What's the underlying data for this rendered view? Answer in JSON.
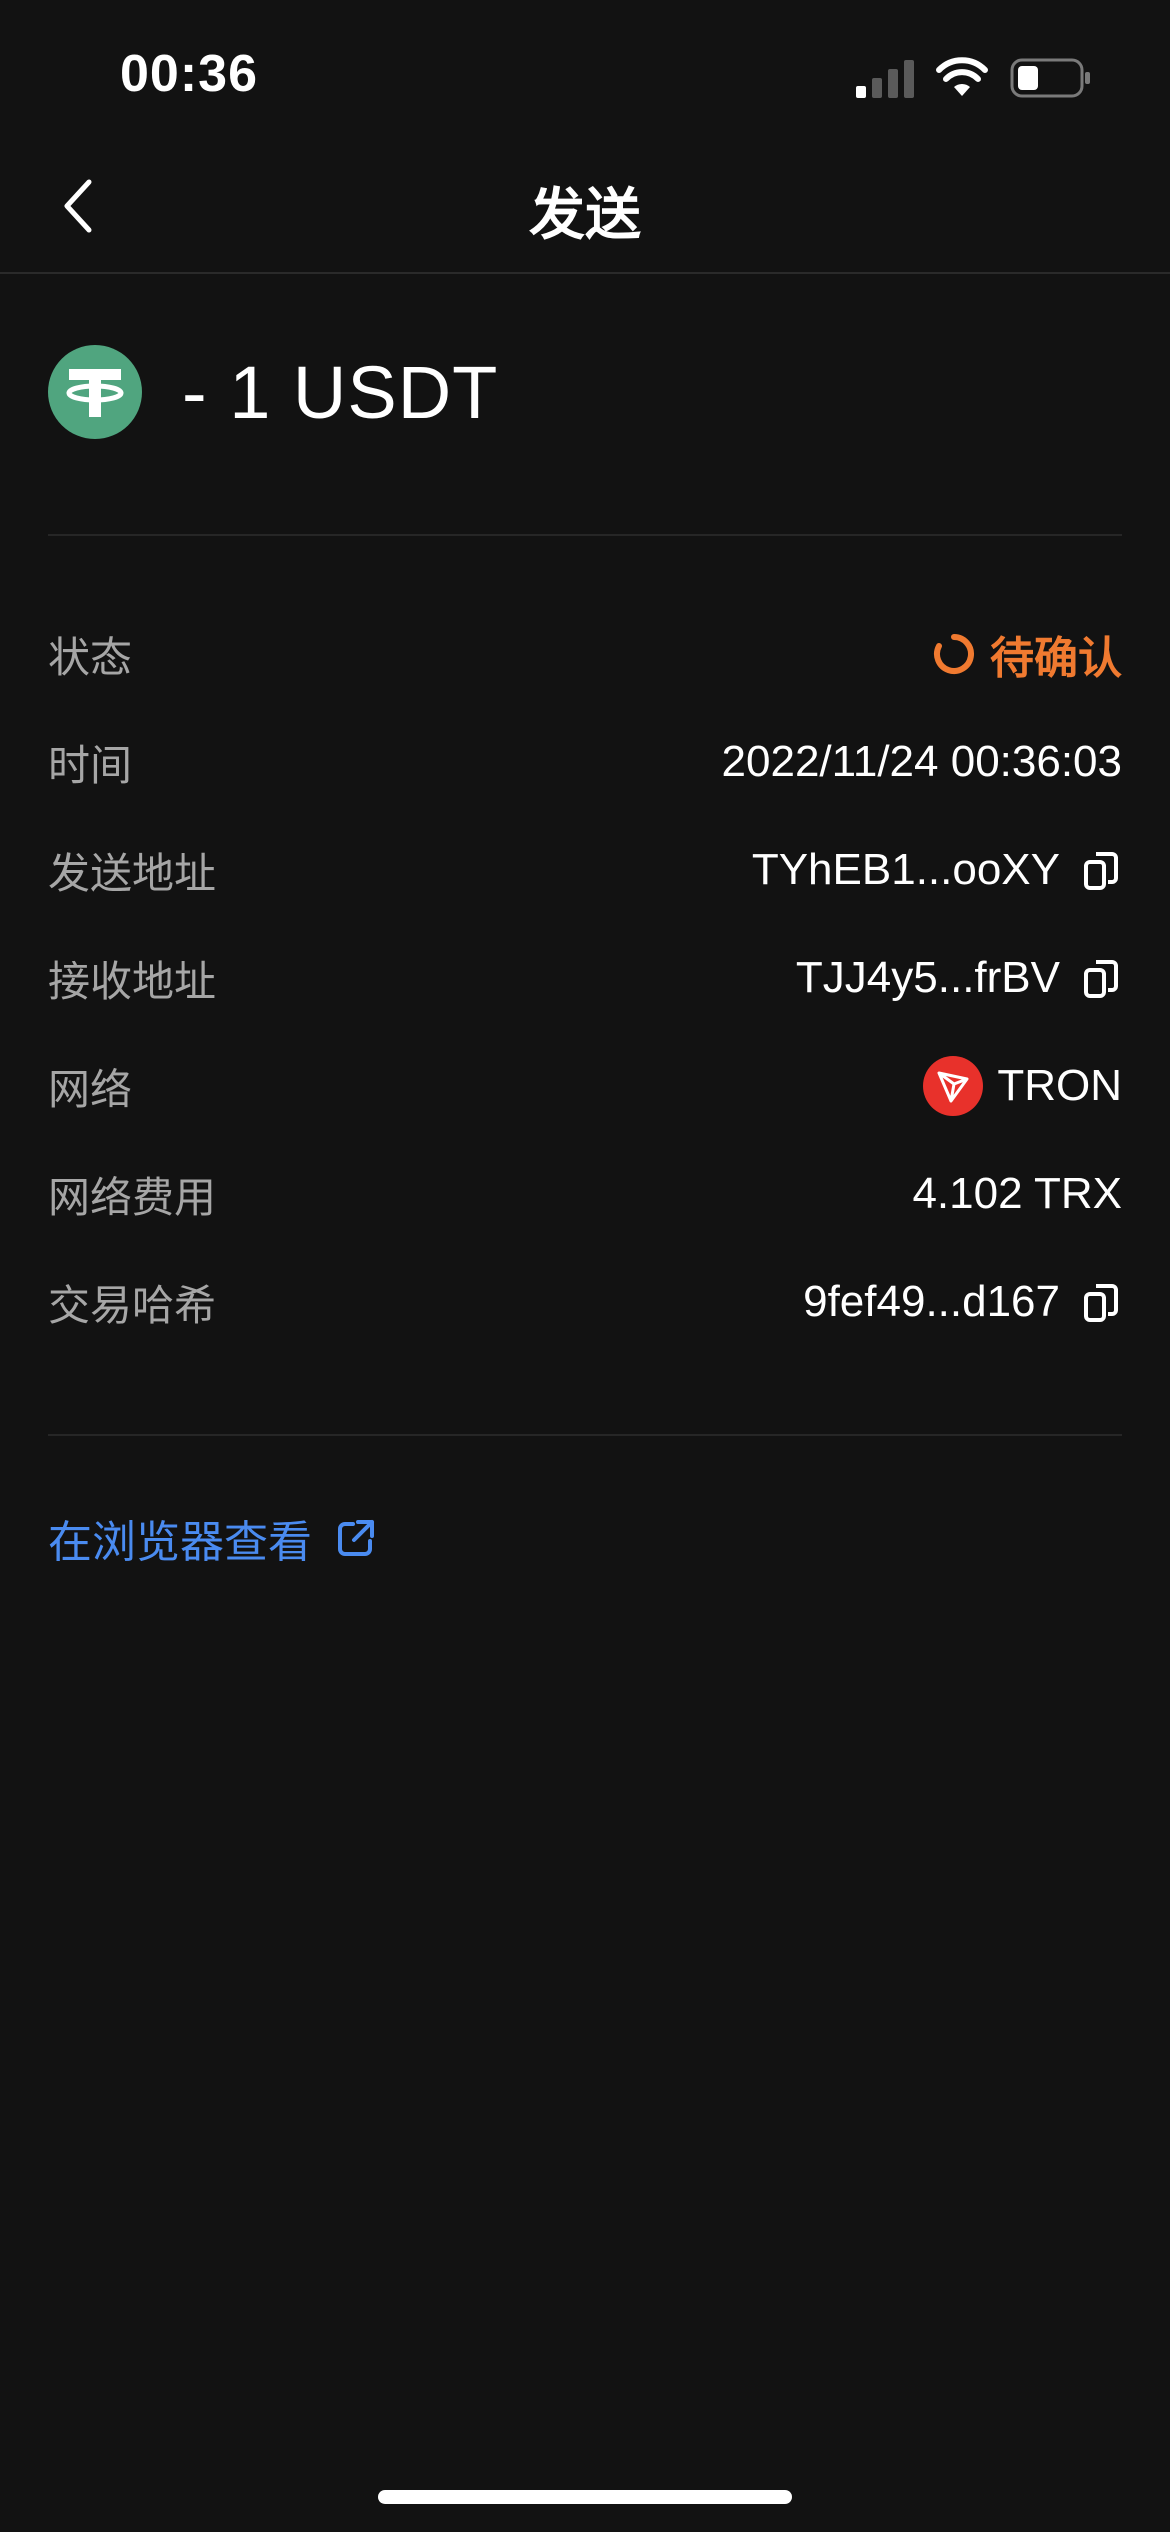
{
  "status_bar": {
    "time": "00:36"
  },
  "nav": {
    "title": "发送"
  },
  "transaction": {
    "coin_icon": "tether-icon",
    "amount": "- 1 USDT"
  },
  "details": {
    "status": {
      "label": "状态",
      "value": "待确认"
    },
    "time": {
      "label": "时间",
      "value": "2022/11/24 00:36:03"
    },
    "from": {
      "label": "发送地址",
      "value": "TYhEB1...ooXY"
    },
    "to": {
      "label": "接收地址",
      "value": "TJJ4y5...frBV"
    },
    "network": {
      "label": "网络",
      "value": "TRON"
    },
    "fee": {
      "label": "网络费用",
      "value": "4.102 TRX"
    },
    "hash": {
      "label": "交易哈希",
      "value": "9fef49...d167"
    }
  },
  "link": {
    "label": "在浏览器查看"
  },
  "colors": {
    "background": "#121212",
    "pending": "#f07a30",
    "link": "#4a8bf0",
    "tether": "#50a57f",
    "tron": "#e8312b"
  }
}
